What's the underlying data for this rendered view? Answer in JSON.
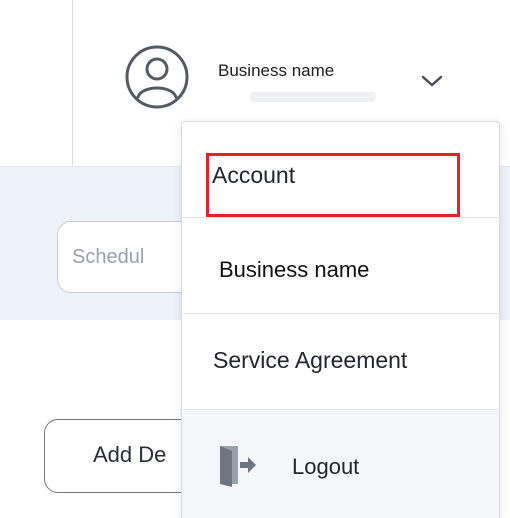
{
  "header": {
    "user_name": "Business  name",
    "avatar_icon": "user-circle-icon",
    "dropdown_icon": "chevron-down-icon"
  },
  "toolbar": {
    "schedule_field_text": "Schedul"
  },
  "actions": {
    "add_button_label": "Add De"
  },
  "account_menu": {
    "items": [
      {
        "label": "Account",
        "highlighted": true
      },
      {
        "label": "Business name"
      },
      {
        "label": "Service Agreement"
      },
      {
        "label": "Logout",
        "icon": "logout-door-icon"
      }
    ]
  },
  "colors": {
    "highlight_border": "#e52129",
    "band_background": "#eef2fa",
    "logout_row_background": "#f4f6f9"
  }
}
